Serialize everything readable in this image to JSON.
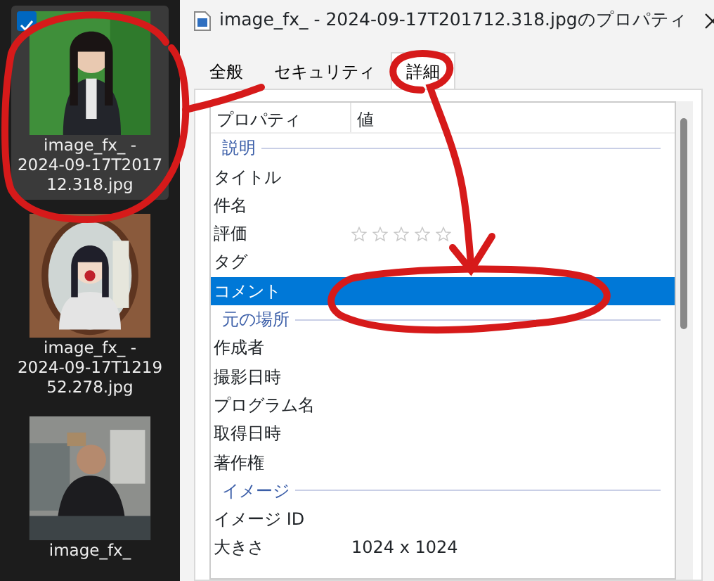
{
  "thumbnails": [
    {
      "kind": "picture",
      "selected": true,
      "checked": true,
      "label": [
        "image_fx_ -",
        "2024-09-17T2017",
        "12.318.jpg"
      ]
    },
    {
      "kind": "picture",
      "selected": false,
      "checked": false,
      "label": [
        "image_fx_ -",
        "2024-09-17T1219",
        "52.278.jpg"
      ]
    },
    {
      "kind": "picture",
      "selected": false,
      "checked": false,
      "label": [
        "image_fx_"
      ]
    }
  ],
  "dialog": {
    "title": "image_fx_ - 2024-09-17T201712.318.jpgのプロパティ",
    "tabs": [
      {
        "label": "全般",
        "selected": false
      },
      {
        "label": "セキュリティ",
        "selected": false
      },
      {
        "label": "詳細",
        "selected": true
      }
    ],
    "columns": [
      "プロパティ",
      "値"
    ],
    "rows": [
      {
        "kind": "section",
        "label": "説明"
      },
      {
        "kind": "property",
        "label": "タイトル",
        "selected": false
      },
      {
        "kind": "property",
        "label": "件名",
        "selected": false
      },
      {
        "kind": "rating",
        "label": "評価",
        "stars": 0,
        "selected": false
      },
      {
        "kind": "property",
        "label": "タグ",
        "selected": false
      },
      {
        "kind": "property",
        "label": "コメント",
        "selected": true
      },
      {
        "kind": "section",
        "label": "元の場所"
      },
      {
        "kind": "property",
        "label": "作成者",
        "selected": false
      },
      {
        "kind": "property",
        "label": "撮影日時",
        "selected": false
      },
      {
        "kind": "property",
        "label": "プログラム名",
        "selected": false
      },
      {
        "kind": "property",
        "label": "取得日時",
        "selected": false
      },
      {
        "kind": "property",
        "label": "著作権",
        "selected": false
      },
      {
        "kind": "section",
        "label": "イメージ"
      },
      {
        "kind": "property",
        "label": "イメージ ID",
        "selected": false
      },
      {
        "kind": "property",
        "label": "大きさ",
        "value": "1024 x 1024",
        "selected": false
      }
    ]
  }
}
